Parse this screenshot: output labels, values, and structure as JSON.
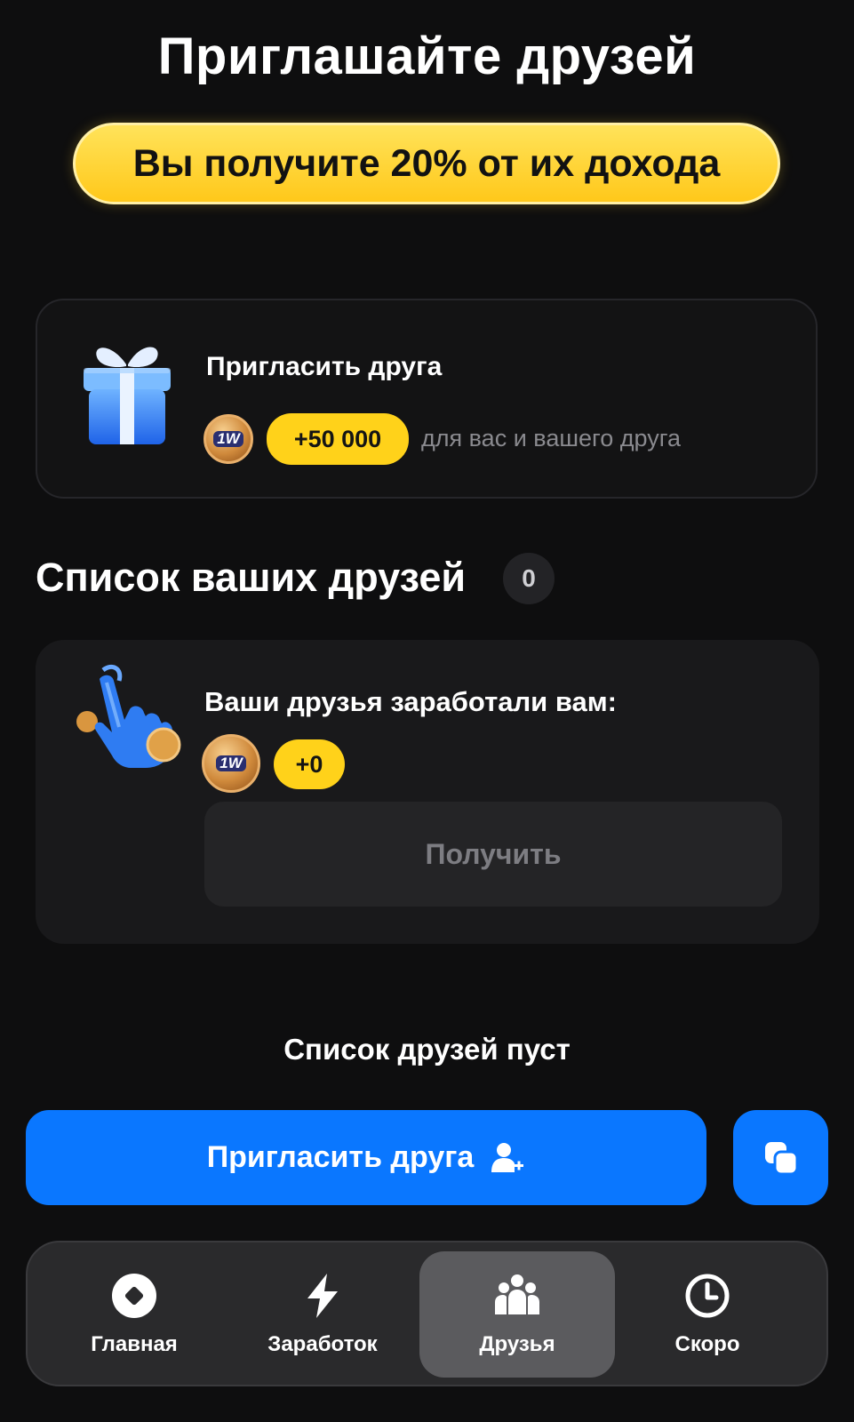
{
  "header": {
    "title": "Приглашайте друзей",
    "promo": "Вы получите 20% от их дохода"
  },
  "invite_card": {
    "title": "Пригласить друга",
    "coin_label": "1W",
    "bonus": "+50 000",
    "subtitle": "для вас и вашего друга"
  },
  "friends": {
    "header": "Список ваших друзей",
    "count": "0",
    "earn_title": "Ваши друзья заработали вам:",
    "coin_label": "1W",
    "earned": "+0",
    "claim_label": "Получить",
    "empty_text": "Список друзей пуст"
  },
  "actions": {
    "invite_label": "Пригласить друга"
  },
  "nav": {
    "items": [
      {
        "label": "Главная",
        "icon": "home-diamond-icon"
      },
      {
        "label": "Заработок",
        "icon": "lightning-icon"
      },
      {
        "label": "Друзья",
        "icon": "friends-group-icon",
        "active": true
      },
      {
        "label": "Скоро",
        "icon": "clock-icon"
      }
    ]
  },
  "colors": {
    "background": "#0e0e0f",
    "accent_blue": "#0a77ff",
    "accent_yellow": "#ffd21a"
  }
}
